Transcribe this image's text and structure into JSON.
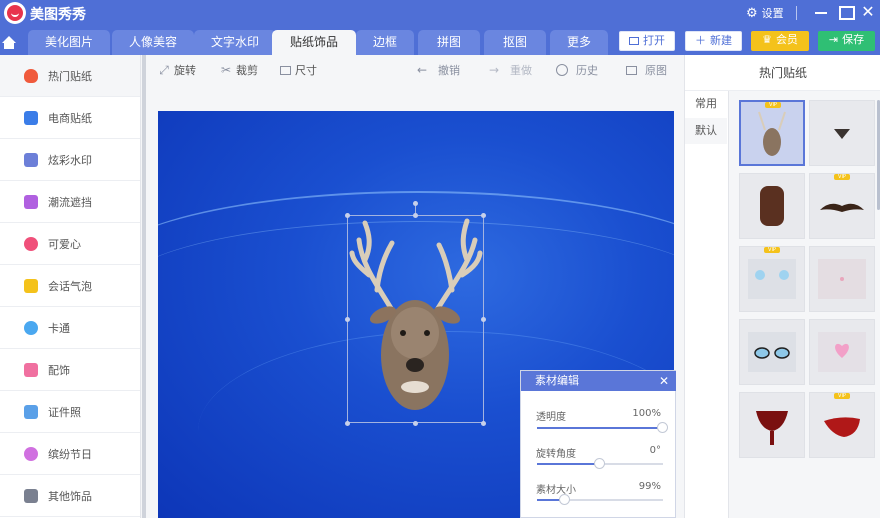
{
  "app": {
    "title": "美图秀秀",
    "settings_label": "设置"
  },
  "tabs": [
    "美化图片",
    "人像美容",
    "文字水印",
    "贴纸饰品",
    "边框",
    "拼图",
    "抠图",
    "更多"
  ],
  "actions": {
    "open": "打开",
    "new": "新建",
    "member": "会员",
    "save": "保存"
  },
  "sidebar": {
    "items": [
      {
        "label": "热门贴纸",
        "color": "#f05a3c"
      },
      {
        "label": "电商贴纸",
        "color": "#3b7de8"
      },
      {
        "label": "炫彩水印",
        "color": "#6c7fd8"
      },
      {
        "label": "潮流遮挡",
        "color": "#b060e0"
      },
      {
        "label": "可爱心",
        "color": "#f0507a"
      },
      {
        "label": "会话气泡",
        "color": "#f4c21b"
      },
      {
        "label": "卡通",
        "color": "#4aa8f0"
      },
      {
        "label": "配饰",
        "color": "#f070a0"
      },
      {
        "label": "证件照",
        "color": "#5aa0e8"
      },
      {
        "label": "缤纷节日",
        "color": "#d070e0"
      },
      {
        "label": "其他饰品",
        "color": "#7a8090"
      }
    ]
  },
  "toolbar": {
    "rotate": "旋转",
    "crop": "裁剪",
    "size": "尺寸",
    "undo": "撤销",
    "redo": "重做",
    "history": "历史",
    "original": "原图"
  },
  "edit_panel": {
    "title": "素材编辑",
    "opacity_label": "透明度",
    "opacity_value": "100%",
    "opacity": 1.0,
    "rotation_label": "旋转角度",
    "rotation_value": "0°",
    "rotation": 0.5,
    "size_label": "素材大小",
    "size_value": "99%",
    "size": 0.22
  },
  "right_panel": {
    "title": "热门贴纸",
    "categories": [
      "常用",
      "默认"
    ],
    "thumbnails": [
      "deer",
      "moustache-small",
      "vest",
      "moustache",
      "glasses-eyes",
      "blush",
      "glasses",
      "heart-balloon",
      "goblet",
      "tongue"
    ],
    "vip_label": "VIP"
  }
}
